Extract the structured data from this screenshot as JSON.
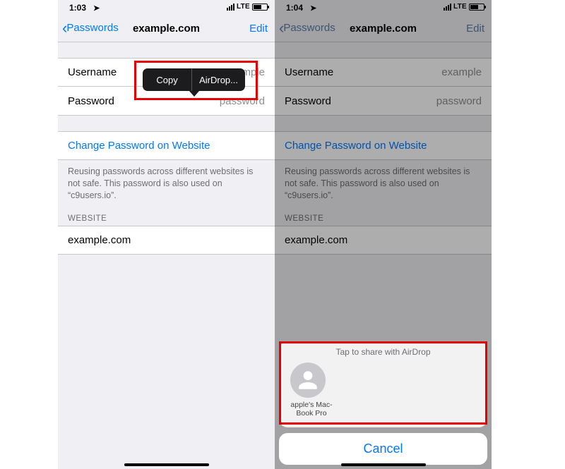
{
  "left": {
    "status": {
      "time": "1:03",
      "network": "LTE"
    },
    "nav": {
      "back": "Passwords",
      "title": "example.com",
      "edit": "Edit"
    },
    "fields": {
      "username_label": "Username",
      "username_value": "example",
      "password_label": "Password",
      "password_value": "password"
    },
    "change_link": "Change Password on Website",
    "footnote": "Reusing passwords across different websites is not safe. This password is also used on “c9users.io”.",
    "section_header": "WEBSITE",
    "website": "example.com",
    "callout": {
      "copy": "Copy",
      "airdrop": "AirDrop..."
    }
  },
  "right": {
    "status": {
      "time": "1:04",
      "network": "LTE"
    },
    "nav": {
      "back": "Passwords",
      "title": "example.com",
      "edit": "Edit"
    },
    "fields": {
      "username_label": "Username",
      "username_value": "example",
      "password_label": "Password",
      "password_value": "password"
    },
    "change_link": "Change Password on Website",
    "footnote": "Reusing passwords across different websites is not safe. This password is also used on “c9users.io”.",
    "section_header": "WEBSITE",
    "website": "example.com",
    "sheet": {
      "hint": "Tap to share with AirDrop",
      "target_name": "apple's Mac-\nBook Pro",
      "cancel": "Cancel"
    }
  }
}
